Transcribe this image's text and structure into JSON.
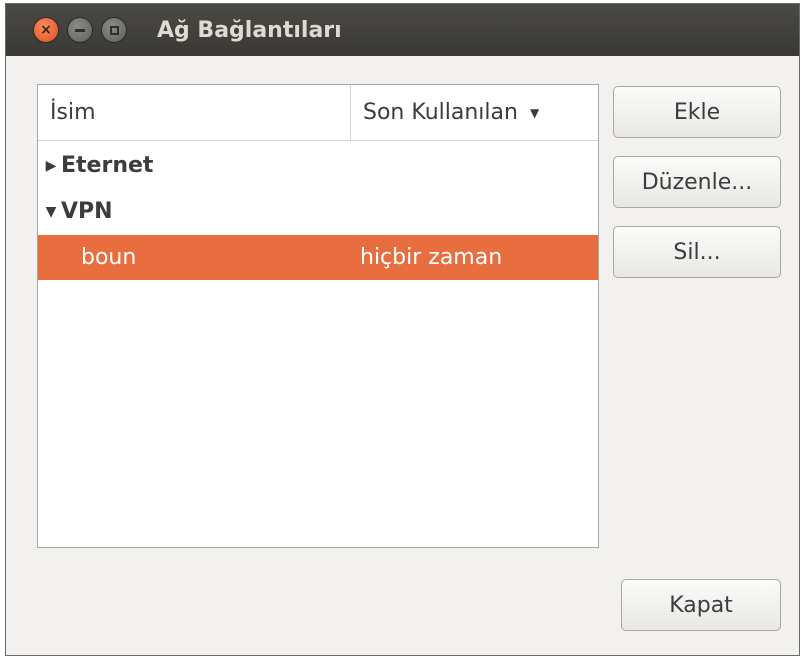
{
  "window": {
    "title": "Ağ Bağlantıları",
    "controls": {
      "close": "×"
    }
  },
  "list": {
    "columns": {
      "name": "İsim",
      "last_used": "Son Kullanılan"
    },
    "groups": [
      {
        "label": "Eternet",
        "expander": "▶"
      },
      {
        "label": "VPN",
        "expander": "▼"
      }
    ],
    "selected_row": {
      "name": "boun",
      "last_used": "hiçbir zaman"
    },
    "sort_indicator": "▼"
  },
  "buttons": {
    "add": "Ekle",
    "edit": "Düzenle...",
    "delete": "Sil...",
    "close": "Kapat"
  },
  "colors": {
    "selection": "#e86e3f",
    "titlebar": "#3e3d39",
    "close_button": "#e2501c"
  }
}
